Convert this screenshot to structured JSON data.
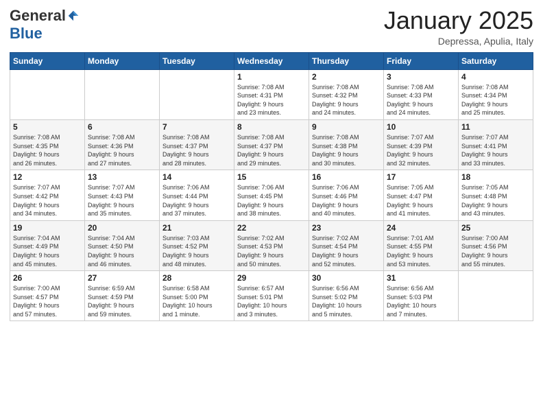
{
  "logo": {
    "general": "General",
    "blue": "Blue"
  },
  "header": {
    "month": "January 2025",
    "location": "Depressa, Apulia, Italy"
  },
  "weekdays": [
    "Sunday",
    "Monday",
    "Tuesday",
    "Wednesday",
    "Thursday",
    "Friday",
    "Saturday"
  ],
  "weeks": [
    [
      {
        "day": "",
        "info": ""
      },
      {
        "day": "",
        "info": ""
      },
      {
        "day": "",
        "info": ""
      },
      {
        "day": "1",
        "info": "Sunrise: 7:08 AM\nSunset: 4:31 PM\nDaylight: 9 hours\nand 23 minutes."
      },
      {
        "day": "2",
        "info": "Sunrise: 7:08 AM\nSunset: 4:32 PM\nDaylight: 9 hours\nand 24 minutes."
      },
      {
        "day": "3",
        "info": "Sunrise: 7:08 AM\nSunset: 4:33 PM\nDaylight: 9 hours\nand 24 minutes."
      },
      {
        "day": "4",
        "info": "Sunrise: 7:08 AM\nSunset: 4:34 PM\nDaylight: 9 hours\nand 25 minutes."
      }
    ],
    [
      {
        "day": "5",
        "info": "Sunrise: 7:08 AM\nSunset: 4:35 PM\nDaylight: 9 hours\nand 26 minutes."
      },
      {
        "day": "6",
        "info": "Sunrise: 7:08 AM\nSunset: 4:36 PM\nDaylight: 9 hours\nand 27 minutes."
      },
      {
        "day": "7",
        "info": "Sunrise: 7:08 AM\nSunset: 4:37 PM\nDaylight: 9 hours\nand 28 minutes."
      },
      {
        "day": "8",
        "info": "Sunrise: 7:08 AM\nSunset: 4:37 PM\nDaylight: 9 hours\nand 29 minutes."
      },
      {
        "day": "9",
        "info": "Sunrise: 7:08 AM\nSunset: 4:38 PM\nDaylight: 9 hours\nand 30 minutes."
      },
      {
        "day": "10",
        "info": "Sunrise: 7:07 AM\nSunset: 4:39 PM\nDaylight: 9 hours\nand 32 minutes."
      },
      {
        "day": "11",
        "info": "Sunrise: 7:07 AM\nSunset: 4:41 PM\nDaylight: 9 hours\nand 33 minutes."
      }
    ],
    [
      {
        "day": "12",
        "info": "Sunrise: 7:07 AM\nSunset: 4:42 PM\nDaylight: 9 hours\nand 34 minutes."
      },
      {
        "day": "13",
        "info": "Sunrise: 7:07 AM\nSunset: 4:43 PM\nDaylight: 9 hours\nand 35 minutes."
      },
      {
        "day": "14",
        "info": "Sunrise: 7:06 AM\nSunset: 4:44 PM\nDaylight: 9 hours\nand 37 minutes."
      },
      {
        "day": "15",
        "info": "Sunrise: 7:06 AM\nSunset: 4:45 PM\nDaylight: 9 hours\nand 38 minutes."
      },
      {
        "day": "16",
        "info": "Sunrise: 7:06 AM\nSunset: 4:46 PM\nDaylight: 9 hours\nand 40 minutes."
      },
      {
        "day": "17",
        "info": "Sunrise: 7:05 AM\nSunset: 4:47 PM\nDaylight: 9 hours\nand 41 minutes."
      },
      {
        "day": "18",
        "info": "Sunrise: 7:05 AM\nSunset: 4:48 PM\nDaylight: 9 hours\nand 43 minutes."
      }
    ],
    [
      {
        "day": "19",
        "info": "Sunrise: 7:04 AM\nSunset: 4:49 PM\nDaylight: 9 hours\nand 45 minutes."
      },
      {
        "day": "20",
        "info": "Sunrise: 7:04 AM\nSunset: 4:50 PM\nDaylight: 9 hours\nand 46 minutes."
      },
      {
        "day": "21",
        "info": "Sunrise: 7:03 AM\nSunset: 4:52 PM\nDaylight: 9 hours\nand 48 minutes."
      },
      {
        "day": "22",
        "info": "Sunrise: 7:02 AM\nSunset: 4:53 PM\nDaylight: 9 hours\nand 50 minutes."
      },
      {
        "day": "23",
        "info": "Sunrise: 7:02 AM\nSunset: 4:54 PM\nDaylight: 9 hours\nand 52 minutes."
      },
      {
        "day": "24",
        "info": "Sunrise: 7:01 AM\nSunset: 4:55 PM\nDaylight: 9 hours\nand 53 minutes."
      },
      {
        "day": "25",
        "info": "Sunrise: 7:00 AM\nSunset: 4:56 PM\nDaylight: 9 hours\nand 55 minutes."
      }
    ],
    [
      {
        "day": "26",
        "info": "Sunrise: 7:00 AM\nSunset: 4:57 PM\nDaylight: 9 hours\nand 57 minutes."
      },
      {
        "day": "27",
        "info": "Sunrise: 6:59 AM\nSunset: 4:59 PM\nDaylight: 9 hours\nand 59 minutes."
      },
      {
        "day": "28",
        "info": "Sunrise: 6:58 AM\nSunset: 5:00 PM\nDaylight: 10 hours\nand 1 minute."
      },
      {
        "day": "29",
        "info": "Sunrise: 6:57 AM\nSunset: 5:01 PM\nDaylight: 10 hours\nand 3 minutes."
      },
      {
        "day": "30",
        "info": "Sunrise: 6:56 AM\nSunset: 5:02 PM\nDaylight: 10 hours\nand 5 minutes."
      },
      {
        "day": "31",
        "info": "Sunrise: 6:56 AM\nSunset: 5:03 PM\nDaylight: 10 hours\nand 7 minutes."
      },
      {
        "day": "",
        "info": ""
      }
    ]
  ]
}
